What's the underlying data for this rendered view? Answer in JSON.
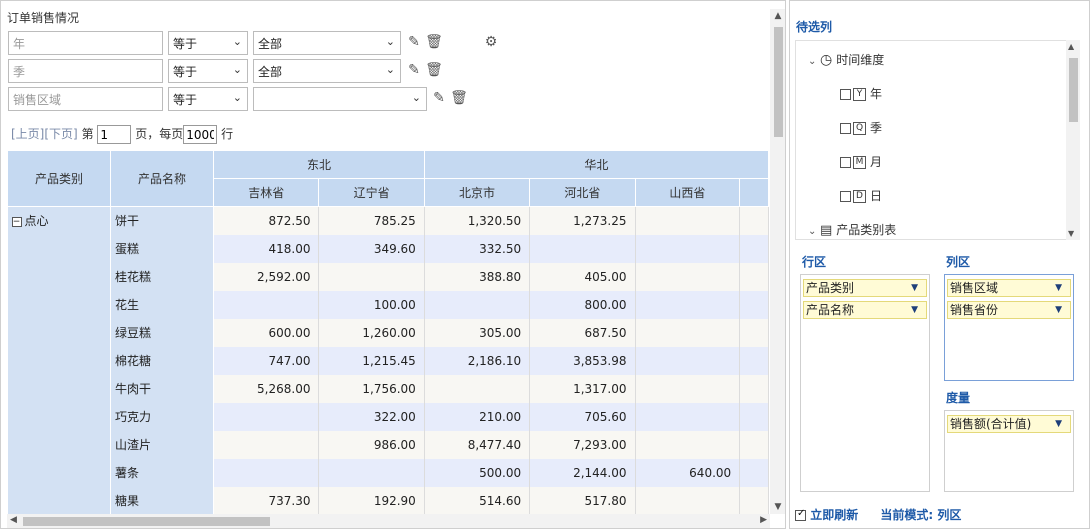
{
  "report_title": "订单销售情况",
  "filters": [
    {
      "field": "年",
      "op": "等于",
      "value": "全部"
    },
    {
      "field": "季",
      "op": "等于",
      "value": "全部"
    },
    {
      "field": "销售区域",
      "op": "等于",
      "value": ""
    }
  ],
  "pager": {
    "prev": "[上页]",
    "next": "[下页]",
    "page_prefix": "第",
    "page": "1",
    "page_suffix": "页，每页",
    "page_size": "1000",
    "rows_suffix": "行"
  },
  "pivot": {
    "row_headers": [
      "产品类别",
      "产品名称"
    ],
    "regions": [
      "东北",
      "华北"
    ],
    "provinces": [
      "吉林省",
      "辽宁省",
      "北京市",
      "河北省",
      "山西省"
    ],
    "category": "点心",
    "rows": [
      {
        "name": "饼干",
        "values": [
          "872.50",
          "785.25",
          "1,320.50",
          "1,273.25",
          ""
        ]
      },
      {
        "name": "蛋糕",
        "values": [
          "418.00",
          "349.60",
          "332.50",
          "",
          ""
        ]
      },
      {
        "name": "桂花糕",
        "values": [
          "2,592.00",
          "",
          "388.80",
          "405.00",
          ""
        ]
      },
      {
        "name": "花生",
        "values": [
          "",
          "100.00",
          "",
          "800.00",
          ""
        ]
      },
      {
        "name": "绿豆糕",
        "values": [
          "600.00",
          "1,260.00",
          "305.00",
          "687.50",
          ""
        ]
      },
      {
        "name": "棉花糖",
        "values": [
          "747.00",
          "1,215.45",
          "2,186.10",
          "3,853.98",
          ""
        ]
      },
      {
        "name": "牛肉干",
        "values": [
          "5,268.00",
          "1,756.00",
          "",
          "1,317.00",
          ""
        ]
      },
      {
        "name": "巧克力",
        "values": [
          "",
          "322.00",
          "210.00",
          "705.60",
          ""
        ]
      },
      {
        "name": "山渣片",
        "values": [
          "",
          "986.00",
          "8,477.40",
          "7,293.00",
          ""
        ]
      },
      {
        "name": "薯条",
        "values": [
          "",
          "",
          "500.00",
          "2,144.00",
          "640.00"
        ]
      },
      {
        "name": "糖果",
        "values": [
          "737.30",
          "192.90",
          "514.60",
          "517.80",
          ""
        ]
      }
    ]
  },
  "side": {
    "candidates_title": "待选列",
    "tree": {
      "time_dim": "时间维度",
      "time_items": [
        {
          "icon": "Y",
          "label": "年"
        },
        {
          "icon": "Q",
          "label": "季"
        },
        {
          "icon": "M",
          "label": "月"
        },
        {
          "icon": "D",
          "label": "日"
        }
      ],
      "product_table": "产品类别表"
    },
    "row_zone_title": "行区",
    "row_zone": [
      "产品类别",
      "产品名称"
    ],
    "col_zone_title": "列区",
    "col_zone": [
      "销售区域",
      "销售省份"
    ],
    "measure_title": "度量",
    "measures": [
      "销售额(合计值)"
    ],
    "auto_refresh": "立即刷新",
    "mode_label": "当前模式:",
    "mode_value": "列区"
  }
}
